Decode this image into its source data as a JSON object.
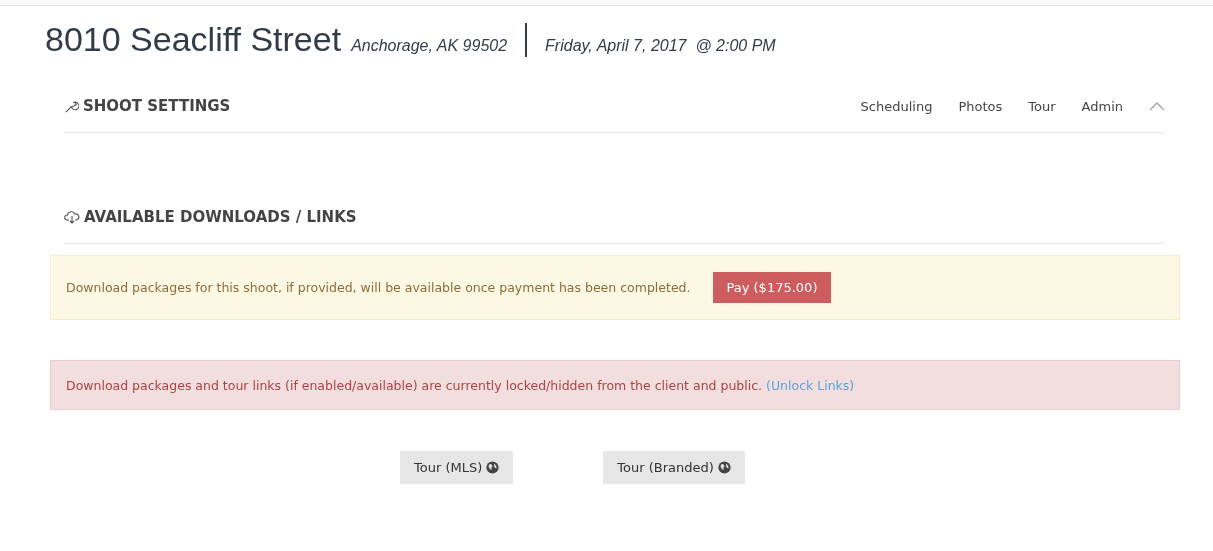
{
  "header": {
    "title": "8010 Seacliff Street",
    "location": "Anchorage, AK 99502",
    "datetime": "Friday, April 7, 2017  @ 2:00 PM"
  },
  "settings_section": {
    "title": "SHOOT SETTINGS",
    "nav": [
      "Scheduling",
      "Photos",
      "Tour",
      "Admin"
    ],
    "expanded": true
  },
  "downloads_section": {
    "title": "AVAILABLE DOWNLOADS / LINKS"
  },
  "payment_alert": {
    "message": "Download packages for this shoot, if provided, will be available once payment has been completed.",
    "button": "Pay ($175.00)"
  },
  "locked_alert": {
    "message": "Download packages and tour links (if enabled/available) are currently locked/hidden from the client and public.",
    "link": "(Unlock Links)"
  },
  "tour_buttons": [
    "Tour (MLS)",
    "Tour (Branded)"
  ]
}
